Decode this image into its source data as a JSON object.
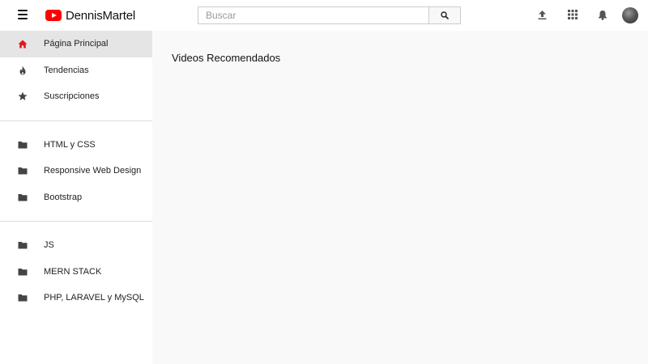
{
  "header": {
    "menu_icon": "hamburger-icon",
    "logo_icon": "youtube-play-icon",
    "brand": "DennisMartel",
    "search": {
      "placeholder": "Buscar",
      "value": "",
      "icon": "search-icon"
    },
    "icons": [
      "upload-icon",
      "apps-grid-icon",
      "bell-icon"
    ],
    "avatar": "user-avatar"
  },
  "sidebar": {
    "primary": [
      {
        "label": "Página Principal",
        "icon": "home-icon",
        "active": true
      },
      {
        "label": "Tendencias",
        "icon": "fire-icon",
        "active": false
      },
      {
        "label": "Suscripciones",
        "icon": "star-icon",
        "active": false
      }
    ],
    "group1": [
      {
        "label": "HTML y CSS",
        "icon": "folder-icon"
      },
      {
        "label": "Responsive Web Design",
        "icon": "folder-icon"
      },
      {
        "label": "Bootstrap",
        "icon": "folder-icon"
      }
    ],
    "group2": [
      {
        "label": "JS",
        "icon": "folder-icon"
      },
      {
        "label": "MERN STACK",
        "icon": "folder-icon"
      },
      {
        "label": "PHP, LARAVEL y MySQL",
        "icon": "folder-icon"
      }
    ]
  },
  "main": {
    "title": "Videos Recomendados"
  },
  "colors": {
    "brand_red": "#ff0000",
    "active_bg": "#e5e5e5",
    "page_bg": "#f9f9f9"
  }
}
